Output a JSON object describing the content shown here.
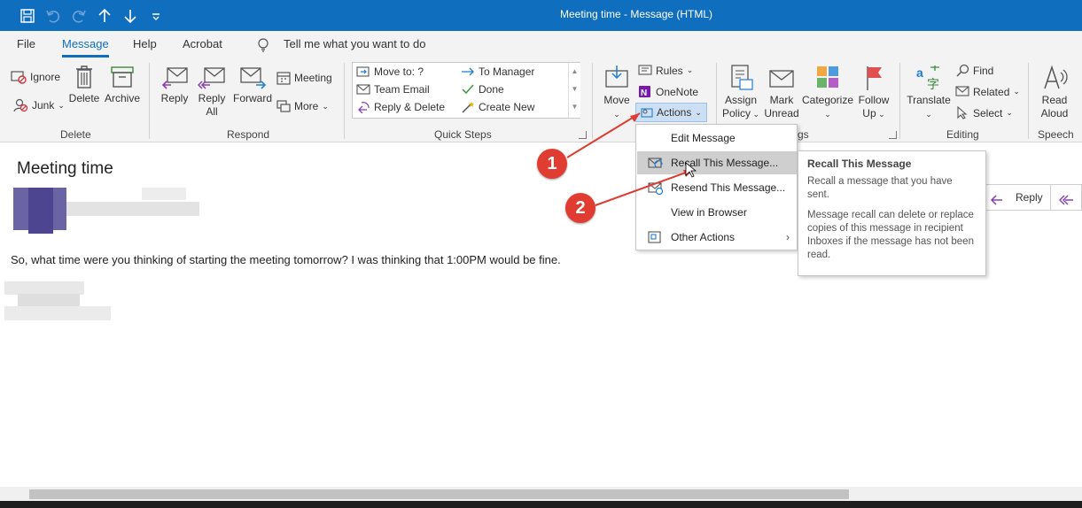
{
  "window": {
    "title": "Meeting time  -  Message (HTML)"
  },
  "qat": {
    "icons": [
      "save-icon",
      "undo-icon",
      "redo-icon",
      "up-arrow-icon",
      "down-arrow-icon",
      "customize-qat-icon"
    ]
  },
  "tabs": [
    {
      "label": "File"
    },
    {
      "label": "Message",
      "active": true
    },
    {
      "label": "Help"
    },
    {
      "label": "Acrobat"
    }
  ],
  "tell_me": {
    "placeholder": "Tell me what you want to do"
  },
  "ribbon": {
    "delete_group": {
      "label": "Delete",
      "ignore": "Ignore",
      "junk": "Junk",
      "delete": "Delete",
      "archive": "Archive"
    },
    "respond_group": {
      "label": "Respond",
      "reply": "Reply",
      "reply_all_1": "Reply",
      "reply_all_2": "All",
      "forward": "Forward",
      "meeting": "Meeting",
      "more": "More"
    },
    "quick_steps": {
      "label": "Quick Steps",
      "items": [
        "Move to: ?",
        "Team Email",
        "Reply & Delete",
        "To Manager",
        "Done",
        "Create New"
      ]
    },
    "move_group": {
      "label": "Move",
      "move": "Move",
      "rules": "Rules",
      "onenote": "OneNote",
      "actions": "Actions"
    },
    "tags_group": {
      "label_fragment": "gs",
      "assign_1": "Assign",
      "assign_2": "Policy",
      "mark_1": "Mark",
      "mark_2": "Unread",
      "categorize": "Categorize",
      "follow_1": "Follow",
      "follow_2": "Up"
    },
    "editing_group": {
      "label": "Editing",
      "translate": "Translate",
      "find": "Find",
      "related": "Related",
      "select": "Select"
    },
    "speech_group": {
      "label": "Speech",
      "read_1": "Read",
      "read_2": "Aloud"
    }
  },
  "message": {
    "subject": "Meeting time",
    "body": "So, what time were you thinking of starting the meeting tomorrow? I was thinking that 1:00PM would be fine.",
    "reply_label": "Reply"
  },
  "actions_menu": {
    "items": [
      {
        "label": "Edit Message"
      },
      {
        "label": "Recall This Message...",
        "highlighted": true
      },
      {
        "label": "Resend This Message..."
      },
      {
        "label": "View in Browser"
      },
      {
        "label": "Other Actions"
      }
    ]
  },
  "tooltip": {
    "title": "Recall This Message",
    "para1": "Recall a message that you have sent.",
    "para2": "Message recall can delete or replace copies of this message in recipient Inboxes if the message has not been read."
  },
  "annotations": {
    "badge1": "1",
    "badge2": "2",
    "color": "#e03c31"
  },
  "colors": {
    "accent": "#106ebe",
    "ribbon_bg": "#f3f3f3",
    "onenote": "#7719aa"
  }
}
